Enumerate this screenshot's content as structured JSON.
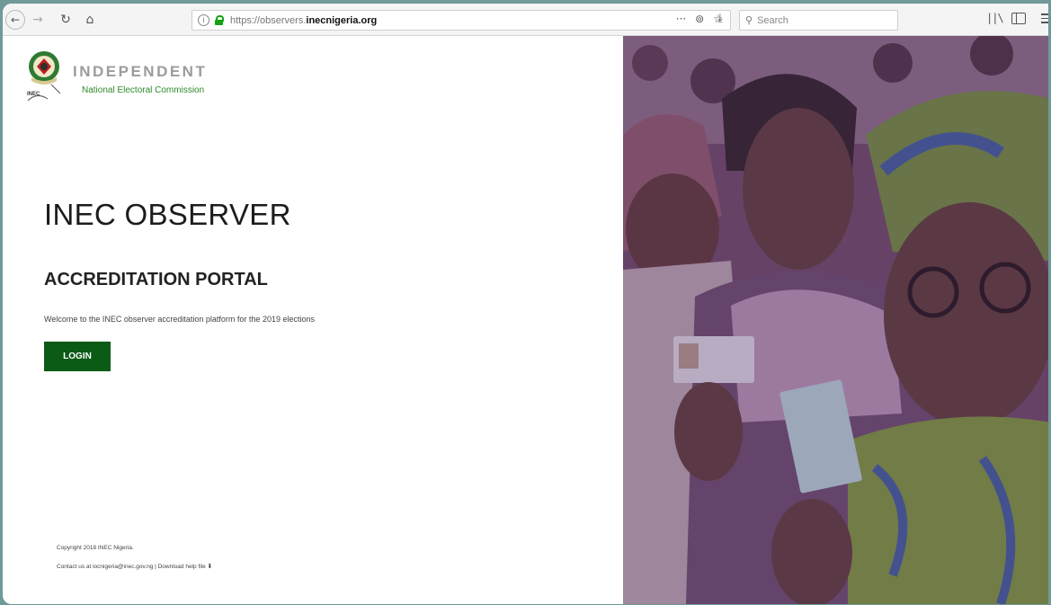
{
  "browser": {
    "url_scheme": "https://",
    "url_subdomain": "observers.",
    "url_host": "inecnigeria.org",
    "search_placeholder": "Search",
    "url_more_glyph": "···"
  },
  "brand": {
    "name": "INDEPENDENT",
    "subtitle": "National Electoral Commission",
    "logo_text": "INEC"
  },
  "main": {
    "title": "INEC OBSERVER",
    "subtitle": "ACCREDITATION PORTAL",
    "welcome": "Welcome to the INEC observer accreditation platform for the 2019 elections",
    "login_label": "LOGIN"
  },
  "footer": {
    "copyright": "Copyright 2018 INEC Nigeria.",
    "contact_prefix": "Contact us at ",
    "contact_email": "iocnigeria@inec.gov.ng",
    "separator": " | ",
    "help_link": "Download help file"
  },
  "colors": {
    "accent_green": "#0b5a16",
    "brand_green": "#2f8a2a",
    "photo_tint": "#5e3a5c"
  }
}
